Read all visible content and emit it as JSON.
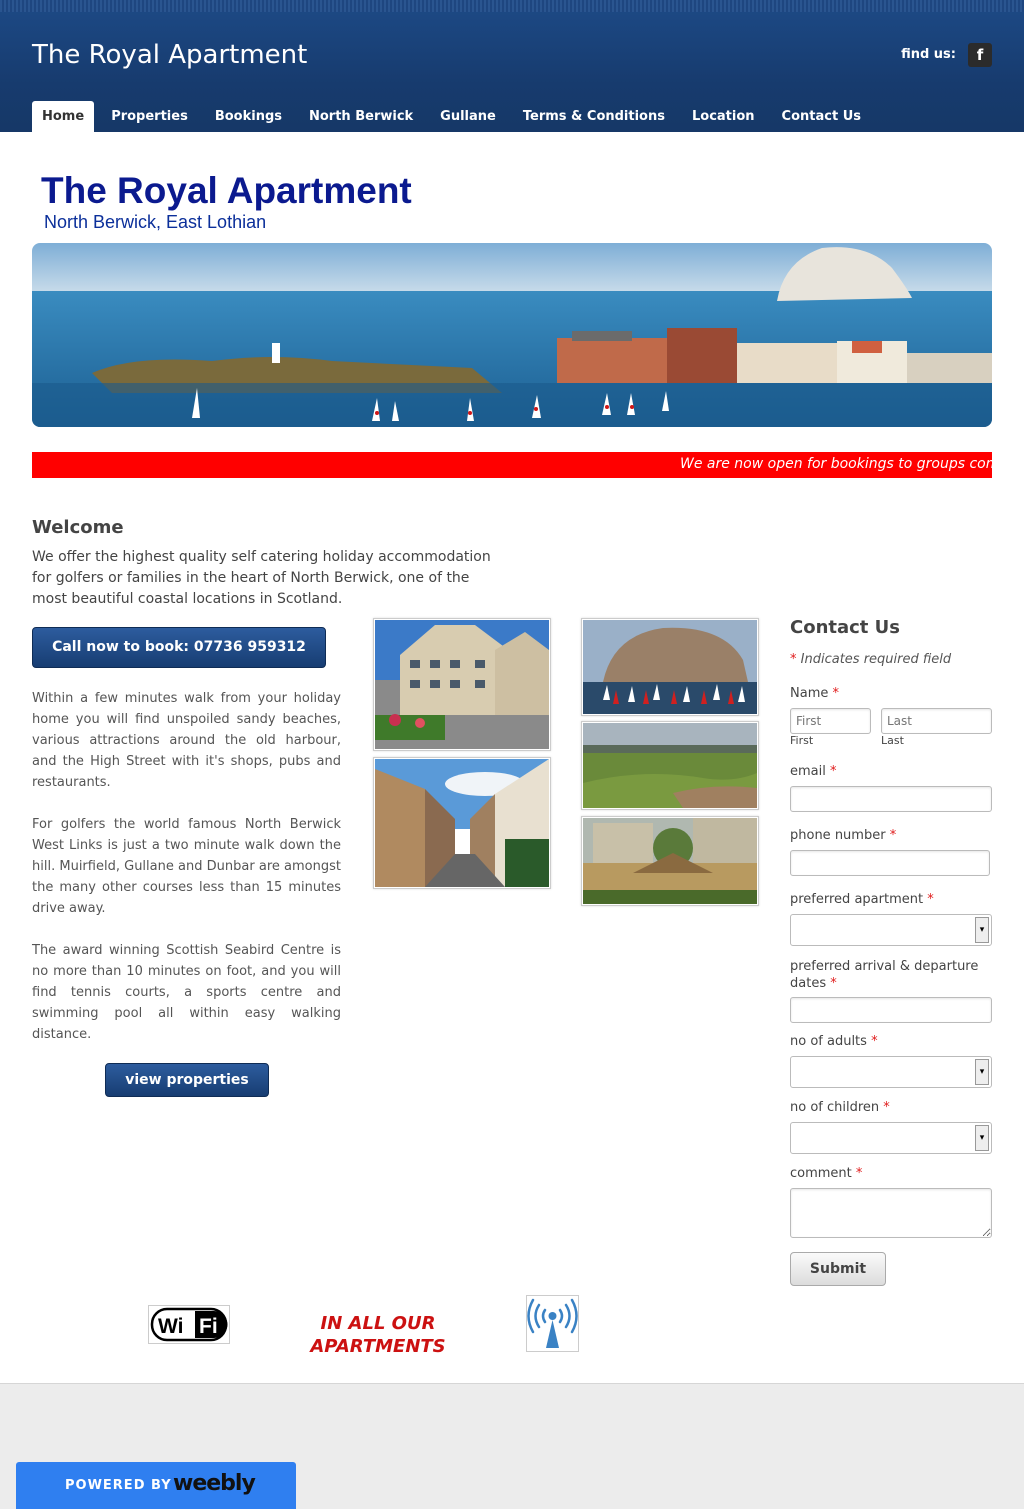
{
  "header": {
    "site_title": "The Royal Apartment",
    "find_us": "find us:",
    "fb_icon": "f"
  },
  "nav": {
    "items": [
      "Home",
      "Properties",
      "Bookings",
      "North Berwick",
      "Gullane",
      "Terms & Conditions",
      "Location",
      "Contact Us"
    ],
    "active": "Home"
  },
  "brand": {
    "title": "The Royal Apartment",
    "subtitle": "North Berwick, East Lothian"
  },
  "ticker": {
    "text": "We are now open for bookings to groups com"
  },
  "welcome": {
    "heading": "Welcome",
    "text": "We offer the highest quality self catering holiday accommodation for golfers or families in the heart of North Berwick, one of the most beautiful coastal locations in Scotland."
  },
  "call_button": "Call now to book: 07736 959312",
  "paragraphs": [
    "Within a few minutes walk from your holiday home you will find unspoiled sandy beaches, various attractions around the old harbour, and the High Street with it's shops, pubs and restaurants.",
    "For golfers the world famous North Berwick West Links is just a two minute walk down the hill.  Muirfield, Gullane and Dunbar are amongst the many other courses less than 15 minutes drive away.",
    "The award winning Scottish Seabird Centre is no more than 10 minutes on foot, and you will find tennis courts, a sports centre and swimming pool all within easy walking distance."
  ],
  "view_button": "view properties",
  "form": {
    "heading": "Contact Us",
    "required_star": "*",
    "required_note": "Indicates required field",
    "name_label": "Name",
    "first_placeholder": "First",
    "last_placeholder": "Last",
    "first_sub": "First",
    "last_sub": "Last",
    "email_label": "email",
    "phone_label": "phone number",
    "apartment_label": "preferred apartment",
    "dates_label": "preferred arrival & departure dates",
    "adults_label": "no of adults",
    "children_label": "no of children",
    "comment_label": "comment",
    "submit": "Submit"
  },
  "footer_badges": {
    "wifi": "WiFi",
    "all_apartments": "IN ALL OUR APARTMENTS"
  },
  "weebly": {
    "powered_by": "POWERED BY",
    "logo": "weebly"
  },
  "colors": {
    "header_blue": "#173b6e",
    "ticker_red": "#ff0000",
    "button_blue": "#1f4a86",
    "weebly_blue": "#2f7ff0"
  }
}
